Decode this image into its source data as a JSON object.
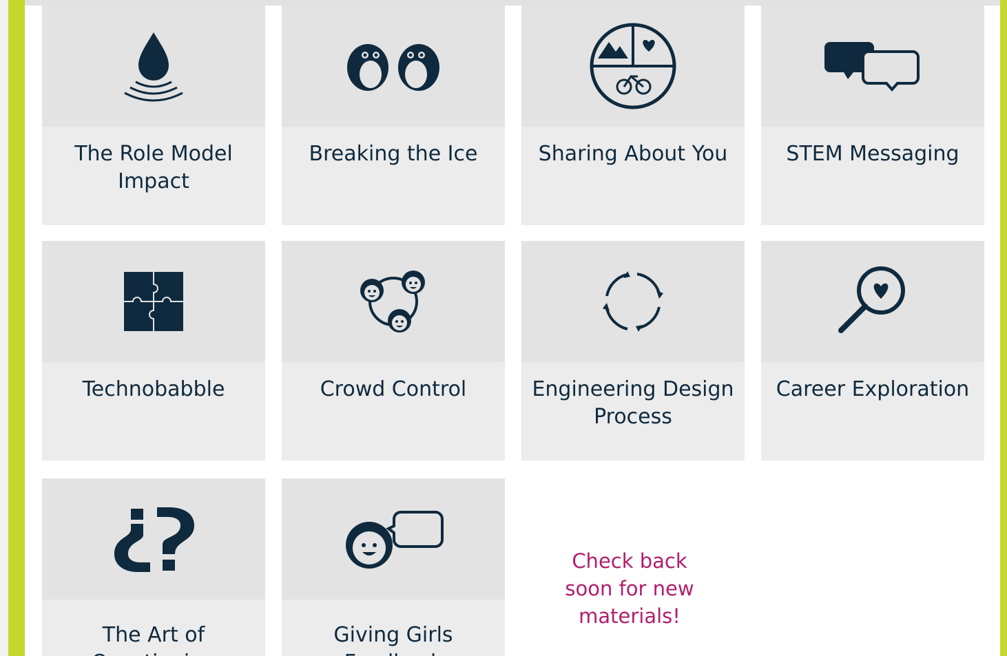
{
  "colors": {
    "frame_green": "#c4d82d",
    "card_bg": "#ececec",
    "icon_bg": "#e3e3e3",
    "navy": "#0f2a3e",
    "message_pink": "#b21e6d"
  },
  "cards": [
    {
      "title": "The Role Model Impact",
      "icon": "water-drop-ripple-icon"
    },
    {
      "title": "Breaking the Ice",
      "icon": "penguins-icon"
    },
    {
      "title": "Sharing About You",
      "icon": "interests-circle-icon"
    },
    {
      "title": "STEM Messaging",
      "icon": "chat-bubbles-icon"
    },
    {
      "title": "Technobabble",
      "icon": "puzzle-icon"
    },
    {
      "title": "Crowd Control",
      "icon": "group-faces-icon"
    },
    {
      "title": "Engineering Design Process",
      "icon": "cycle-arrows-icon"
    },
    {
      "title": "Career Exploration",
      "icon": "magnifier-heart-icon"
    },
    {
      "title": "The Art of Questioning",
      "icon": "question-marks-icon"
    },
    {
      "title": "Giving Girls Feedback",
      "icon": "girl-speech-icon"
    }
  ],
  "message": "Check back soon for new materials!"
}
